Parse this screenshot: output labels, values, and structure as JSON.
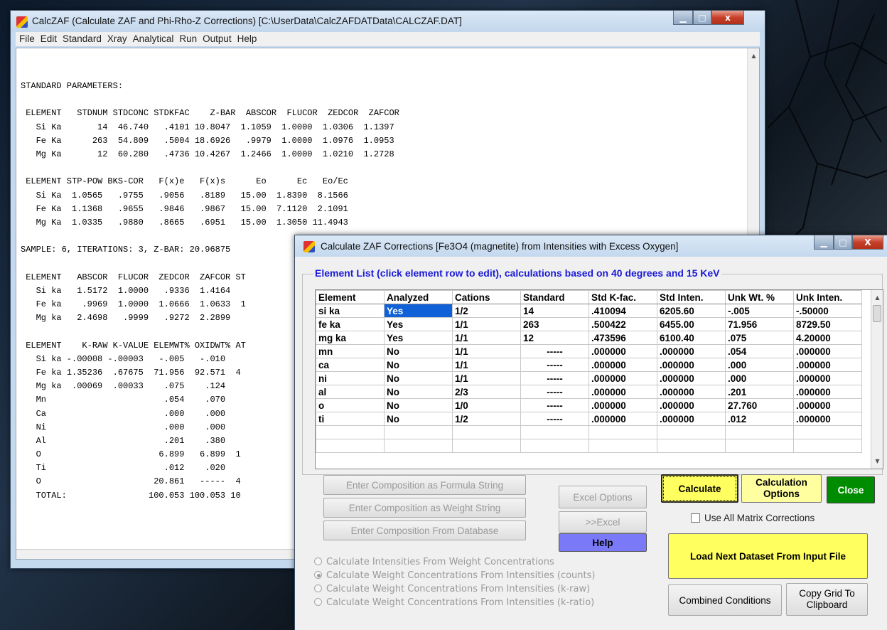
{
  "main_window": {
    "title": "CalcZAF (Calculate ZAF and Phi-Rho-Z Corrections)   [C:\\UserData\\CalcZAFDATData\\CALCZAF.DAT]",
    "controls": {
      "minimize": "▁",
      "maximize": "□",
      "close": "x"
    }
  },
  "menu": [
    "File",
    "Edit",
    "Standard",
    "Xray",
    "Analytical",
    "Run",
    "Output",
    "Help"
  ],
  "report_lines": [
    "STANDARD PARAMETERS:",
    "",
    " ELEMENT   STDNUM STDCONC STDKFAC    Z-BAR  ABSCOR  FLUCOR  ZEDCOR  ZAFCOR",
    "   Si Ka       14  46.740   .4101 10.8047  1.1059  1.0000  1.0306  1.1397",
    "   Fe Ka      263  54.809   .5004 18.6926   .9979  1.0000  1.0976  1.0953",
    "   Mg Ka       12  60.280   .4736 10.4267  1.2466  1.0000  1.0210  1.2728",
    "",
    " ELEMENT STP-POW BKS-COR   F(x)e   F(x)s      Eo      Ec   Eo/Ec",
    "   Si Ka  1.0565   .9755   .9056   .8189   15.00  1.8390  8.1566",
    "   Fe Ka  1.1368   .9655   .9846   .9867   15.00  7.1120  2.1091",
    "   Mg Ka  1.0335   .9880   .8665   .6951   15.00  1.3050 11.4943",
    "",
    "SAMPLE: 6, ITERATIONS: 3, Z-BAR: 20.96875",
    "",
    " ELEMENT   ABSCOR  FLUCOR  ZEDCOR  ZAFCOR ST",
    "   Si ka   1.5172  1.0000   .9336  1.4164",
    "   Fe ka    .9969  1.0000  1.0666  1.0633  1",
    "   Mg ka   2.4698   .9999   .9272  2.2899",
    "",
    " ELEMENT    K-RAW K-VALUE ELEMWT% OXIDWT% AT",
    "   Si ka -.00008 -.00003   -.005   -.010",
    "   Fe ka 1.35236  .67675  71.956  92.571  4",
    "   Mg ka  .00069  .00033    .075    .124",
    "   Mn                       .054    .070",
    "   Ca                       .000    .000",
    "   Ni                       .000    .000",
    "   Al                       .201    .380",
    "   O                       6.899   6.899  1",
    "   Ti                       .012    .020",
    "   O                      20.861   -----  4",
    "   TOTAL:                100.053 100.053 10"
  ],
  "dialog": {
    "title": "Calculate ZAF Corrections   [Fe3O4 (magnetite) from Intensities with Excess Oxygen]",
    "controls": {
      "minimize": "▁",
      "maximize": "□",
      "close": "X"
    },
    "group_label": "Element List (click element row to edit), calculations based on  40 degrees and  15 KeV",
    "grid": {
      "columns": [
        "Element",
        "Analyzed",
        "Cations",
        "Standard",
        "Std K-fac.",
        "Std Inten.",
        "Unk Wt. %",
        "Unk Inten."
      ],
      "rows": [
        [
          "si ka",
          "Yes",
          "1/2",
          "14",
          ".410094",
          "6205.60",
          "-.005",
          "-.50000"
        ],
        [
          "fe ka",
          "Yes",
          "1/1",
          "263",
          ".500422",
          "6455.00",
          "71.956",
          "8729.50"
        ],
        [
          "mg ka",
          "Yes",
          "1/1",
          "12",
          ".473596",
          "6100.40",
          ".075",
          "4.20000"
        ],
        [
          "mn",
          "No",
          "1/1",
          "-----",
          ".000000",
          ".000000",
          ".054",
          ".000000"
        ],
        [
          "ca",
          "No",
          "1/1",
          "-----",
          ".000000",
          ".000000",
          ".000",
          ".000000"
        ],
        [
          "ni",
          "No",
          "1/1",
          "-----",
          ".000000",
          ".000000",
          ".000",
          ".000000"
        ],
        [
          "al",
          "No",
          "2/3",
          "-----",
          ".000000",
          ".000000",
          ".201",
          ".000000"
        ],
        [
          "o",
          "No",
          "1/0",
          "-----",
          ".000000",
          ".000000",
          "27.760",
          ".000000"
        ],
        [
          "ti",
          "No",
          "1/2",
          "-----",
          ".000000",
          ".000000",
          ".012",
          ".000000"
        ],
        [
          "",
          "",
          "",
          "",
          "",
          "",
          "",
          ""
        ],
        [
          "",
          "",
          "",
          "",
          "",
          "",
          "",
          ""
        ]
      ]
    },
    "buttons": {
      "formula_string": "Enter Composition as Formula String",
      "weight_string": "Enter Composition as Weight String",
      "from_database": "Enter Composition From Database",
      "excel_options": "Excel Options",
      "to_excel": ">>Excel",
      "help": "Help",
      "calculate": "Calculate",
      "calc_options": "Calculation Options",
      "close": "Close",
      "load_next": "Load Next Dataset From Input File",
      "combined": "Combined Conditions",
      "copy_grid": "Copy Grid To Clipboard"
    },
    "use_all_matrix": "Use All Matrix Corrections",
    "radio_options": [
      "Calculate Intensities From Weight Concentrations",
      "Calculate Weight Concentrations From Intensities (counts)",
      "Calculate Weight Concentrations From Intensities (k-raw)",
      "Calculate Weight Concentrations From Intensities (k-ratio)"
    ],
    "radio_selected": 1
  }
}
